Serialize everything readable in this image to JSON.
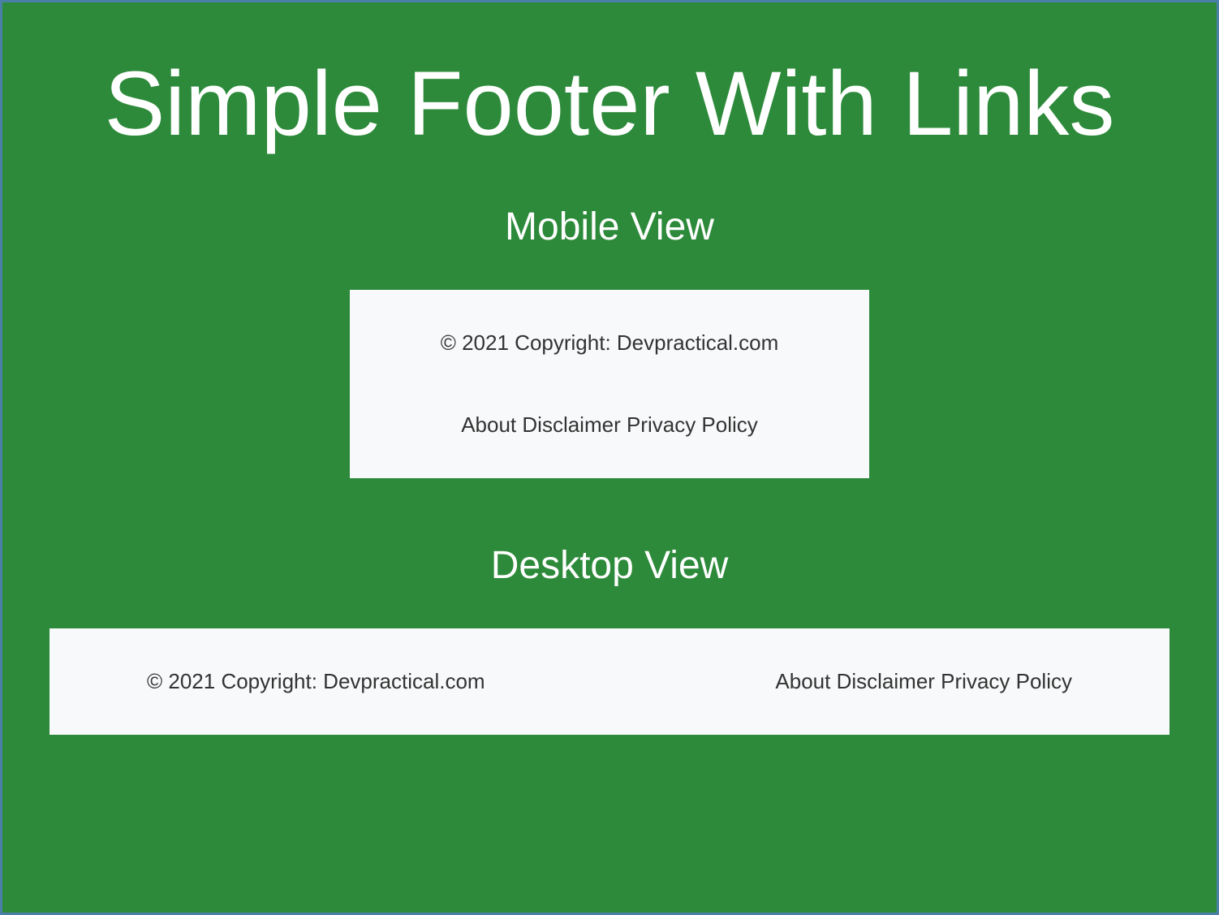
{
  "title": "Simple Footer With Links",
  "sections": {
    "mobile": {
      "heading": "Mobile View",
      "copyright": "© 2021 Copyright: Devpractical.com",
      "links": {
        "about": "About",
        "disclaimer": "Disclaimer",
        "privacy": "Privacy Policy"
      }
    },
    "desktop": {
      "heading": "Desktop View",
      "copyright": "© 2021 Copyright: Devpractical.com",
      "links": {
        "about": "About",
        "disclaimer": "Disclaimer",
        "privacy": "Privacy Policy"
      }
    }
  }
}
